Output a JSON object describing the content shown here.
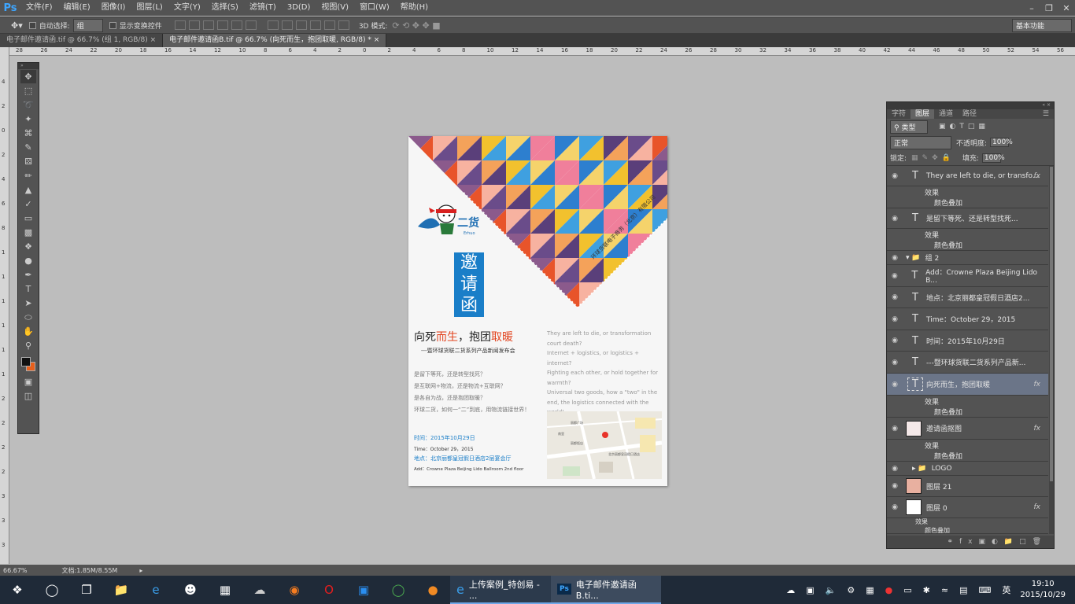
{
  "menu": {
    "logo": "Ps",
    "items": [
      "文件(F)",
      "编辑(E)",
      "图像(I)",
      "图层(L)",
      "文字(Y)",
      "选择(S)",
      "滤镜(T)",
      "3D(D)",
      "视图(V)",
      "窗口(W)",
      "帮助(H)"
    ]
  },
  "options": {
    "auto_select_label": "自动选择:",
    "auto_select_value": "组",
    "show_transform_label": "显示变换控件",
    "mode_3d_label": "3D 模式:",
    "workspace": "基本功能"
  },
  "tabs": [
    {
      "label": "电子邮件邀请函.tif @ 66.7% (组 1, RGB/8)"
    },
    {
      "label": "电子邮件邀请函B.tif @ 66.7% (向死而生，抱团取暖, RGB/8) *"
    }
  ],
  "ruler_h": [
    "28",
    "26",
    "24",
    "22",
    "20",
    "18",
    "16",
    "14",
    "12",
    "10",
    "8",
    "6",
    "4",
    "2",
    "0",
    "2",
    "4",
    "6",
    "8",
    "10",
    "12",
    "14",
    "16",
    "18",
    "20",
    "22",
    "24",
    "26",
    "28",
    "30",
    "32",
    "34",
    "36",
    "38",
    "40",
    "42",
    "44",
    "46",
    "48",
    "50",
    "52",
    "54",
    "56"
  ],
  "ruler_v": [
    "4",
    "2",
    "0",
    "2",
    "4",
    "6",
    "8",
    "1",
    "1",
    "1",
    "1",
    "1",
    "1",
    "2",
    "2",
    "2",
    "2",
    "3",
    "3",
    "3"
  ],
  "document": {
    "logo_text": "二货",
    "logo_sub": "Erhuo",
    "invite_chars": [
      "邀",
      "请",
      "函"
    ],
    "corner_text": "环球货联电子商务（北京）有限公司",
    "headline": {
      "p1": "向死",
      "p2": "而生",
      "p3": "，抱团",
      "p4": "取暖"
    },
    "subtitle": "---暨环球货联二货系列产品新闻发布会",
    "questions": [
      "是留下等死，还是转型找死？",
      "是互联网+物流，还是物流+互联网？",
      "是各自为战，还是抱团取暖？",
      "环球二货，如何一“二”到底，用物流链接世界！"
    ],
    "time_cn": "时间：2015年10月29日",
    "time_en": "Time：October 29，2015",
    "addr_cn": "地点：北京丽都皇冠假日酒店2层宴会厅",
    "addr_en": "Add：Crowne Plaza Beijing Lido Ballroom 2nd floor",
    "right_text": "They are left to die, or transformation court death?\nInternet + logistics, or logistics + internet?\nFighting each other, or hold together for warmth?\nUniversal two goods, how a \"two\" in the end, the logistics connected with the world!",
    "map_labels": [
      "丽都广场",
      "南里",
      "丽都饭店",
      "北京丽都皇冠假日酒店"
    ],
    "colors": {
      "accent_red": "#e2441f",
      "accent_blue": "#1a7ec8"
    }
  },
  "panel": {
    "tabs": [
      "字符",
      "图层",
      "通道",
      "路径"
    ],
    "kind_filter": "类型",
    "blend_mode": "正常",
    "opacity_label": "不透明度:",
    "opacity_value": "100%",
    "lock_label": "锁定:",
    "fill_label": "填充:",
    "fill_value": "100%",
    "effect_label": "效果",
    "color_overlay": "颜色叠加",
    "fx": "fx",
    "layers": [
      {
        "name": "They are left to die, or transfo...",
        "kind": "text",
        "fx": true
      },
      {
        "name": "是留下等死、还是转型找死...",
        "kind": "text",
        "fx": true
      },
      {
        "name": "组 2",
        "kind": "group"
      },
      {
        "name": "Add：Crowne Plaza Beijing Lido B...",
        "kind": "text"
      },
      {
        "name": "地点：北京丽都皇冠假日酒店2...",
        "kind": "text"
      },
      {
        "name": "Time：October 29，2015",
        "kind": "text"
      },
      {
        "name": "时间：2015年10月29日",
        "kind": "text"
      },
      {
        "name": "---暨环球货联二货系列产品新...",
        "kind": "text"
      },
      {
        "name": "向死而生，抱团取暖",
        "kind": "text",
        "fx": true,
        "selected": true
      },
      {
        "name": "邀请函抠图",
        "kind": "image",
        "fx": true
      },
      {
        "name": "LOGO",
        "kind": "group"
      },
      {
        "name": "图层 21",
        "kind": "image"
      },
      {
        "name": "图层 0",
        "kind": "image",
        "fx": true
      }
    ]
  },
  "status": {
    "zoom": "66.67%",
    "doc": "文档:1.85M/8.55M"
  },
  "taskbar": {
    "app1": "上传案例_特创易 - ...",
    "app2": "电子邮件邀请函B.ti...",
    "ime": "英",
    "time": "19:10",
    "date": "2015/10/29"
  }
}
